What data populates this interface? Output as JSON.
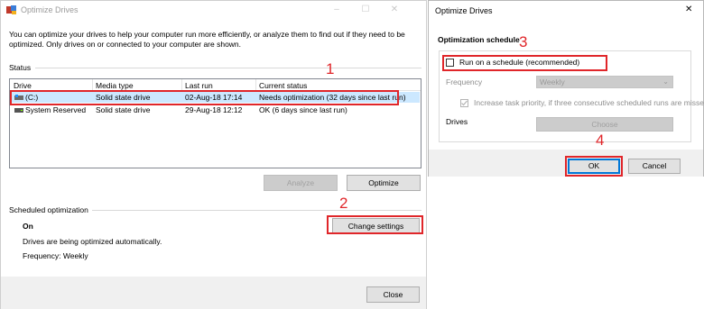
{
  "main_window": {
    "title": "Optimize Drives",
    "window_controls": [
      "–",
      "☐",
      "✕"
    ],
    "description": "You can optimize your drives to help your computer run more efficiently, or analyze them to find out if they need to be optimized. Only drives on or connected to your computer are shown.",
    "status_label": "Status",
    "table": {
      "headers": [
        "Drive",
        "Media type",
        "Last run",
        "Current status"
      ],
      "rows": [
        {
          "drive": "(C:)",
          "media_type": "Solid state drive",
          "last_run": "02-Aug-18 17:14",
          "status": "Needs optimization (32 days since last run)"
        },
        {
          "drive": "System Reserved",
          "media_type": "Solid state drive",
          "last_run": "29-Aug-18 12:12",
          "status": "OK (6 days since last run)"
        }
      ]
    },
    "analyze_button": "Analyze",
    "optimize_button": "Optimize",
    "scheduled_label": "Scheduled optimization",
    "schedule_state": "On",
    "schedule_desc": "Drives are being optimized automatically.",
    "schedule_freq": "Frequency: Weekly",
    "change_settings_button": "Change settings",
    "close_button": "Close"
  },
  "dialog": {
    "title": "Optimize Drives",
    "close_glyph": "✕",
    "section_title": "Optimization schedule",
    "run_on_schedule": "Run on a schedule (recommended)",
    "frequency_label": "Frequency",
    "frequency_value": "Weekly",
    "increase_priority": "Increase task priority, if three consecutive scheduled runs are missed",
    "drives_label": "Drives",
    "choose_button": "Choose",
    "ok_button": "OK",
    "cancel_button": "Cancel"
  },
  "annotations": [
    "1",
    "2",
    "3",
    "4"
  ],
  "colors": {
    "highlight_red": "#e0262a",
    "selection_blue": "#cce8ff",
    "default_button_blue": "#0078d7"
  }
}
